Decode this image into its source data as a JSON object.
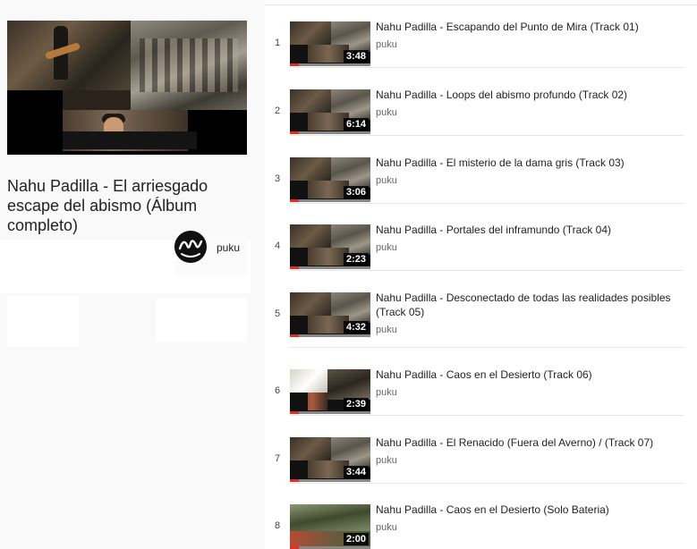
{
  "hero": {
    "title": "Nahu Padilla - El arriesgado escape del abismo (Álbum completo)",
    "channel": "puku",
    "avatar_icon": "puku-logo-icon"
  },
  "playlist": [
    {
      "index": "1",
      "title": "Nahu Padilla - Escapando del Punto de Mira (Track 01)",
      "channel": "puku",
      "duration": "3:48"
    },
    {
      "index": "2",
      "title": "Nahu Padilla - Loops del abismo profundo (Track 02)",
      "channel": "puku",
      "duration": "6:14"
    },
    {
      "index": "3",
      "title": "Nahu Padilla - El misterio de la dama gris (Track 03)",
      "channel": "puku",
      "duration": "3:06"
    },
    {
      "index": "4",
      "title": "Nahu Padilla - Portales del inframundo (Track 04)",
      "channel": "puku",
      "duration": "2:23"
    },
    {
      "index": "5",
      "title": "Nahu Padilla - Desconectado de todas las realidades posibles (Track 05)",
      "channel": "puku",
      "duration": "4:32"
    },
    {
      "index": "6",
      "title": "Nahu Padilla - Caos en el Desierto (Track 06)",
      "channel": "puku",
      "duration": "2:39"
    },
    {
      "index": "7",
      "title": "Nahu Padilla - El Renacido (Fuera del Averno) / (Track 07)",
      "channel": "puku",
      "duration": "3:44"
    },
    {
      "index": "8",
      "title": "Nahu Padilla - Caos en el Desierto (Solo Bateria)",
      "channel": "puku",
      "duration": "2:00"
    }
  ],
  "colors": {
    "progress": "#e52d27",
    "sidebar_bg": "#f9f9f9"
  }
}
